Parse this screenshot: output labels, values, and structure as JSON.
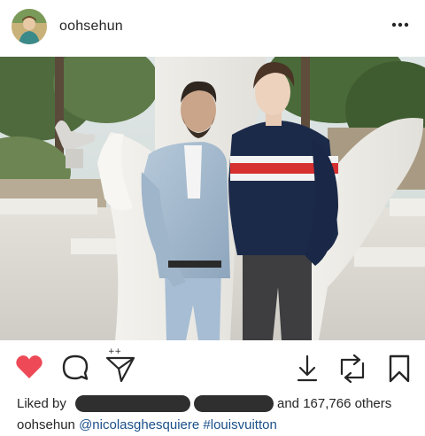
{
  "post": {
    "username": "oohsehun",
    "likes_prefix": "Liked by",
    "likes_suffix": "and 167,766 others",
    "caption_user": "oohsehun",
    "caption_mention": "@nicolasghesquiere",
    "caption_hashtag": "#louisvuitton"
  },
  "icons": {
    "more": "more-options-icon",
    "like": "heart-icon",
    "comment": "comment-icon",
    "share": "direct-share-icon",
    "download": "download-icon",
    "repost": "repost-icon",
    "save": "bookmark-icon"
  },
  "colors": {
    "like": "#ed4956",
    "text": "#262626",
    "link": "#1a4f8a"
  }
}
